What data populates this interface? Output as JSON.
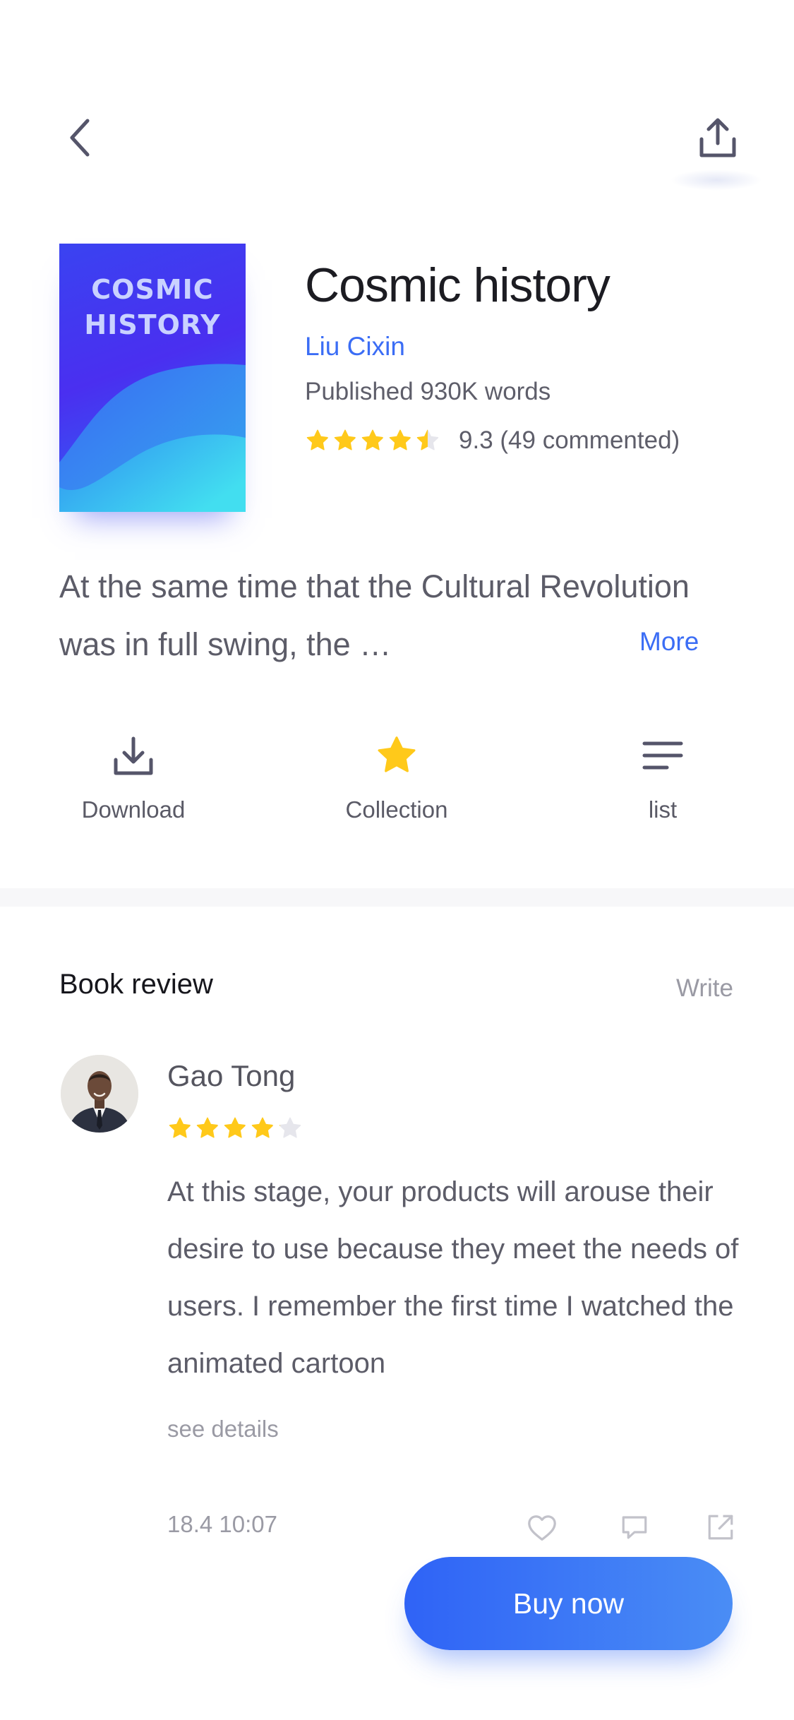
{
  "nav": {
    "back_icon": "chevron-left-icon",
    "share_icon": "share-upload-icon"
  },
  "book": {
    "cover_title": "COSMIC\nHISTORY",
    "title": "Cosmic history",
    "author": "Liu Cixin",
    "published": "Published 930K  words",
    "rating": 9.3,
    "rating_text": "9.3 (49  commented)",
    "star_fill": 4.5,
    "summary": "At the same time that the Cultural Revolution was in full swing, the …",
    "more_label": "More"
  },
  "actions": [
    {
      "label": "Download",
      "icon": "download-icon"
    },
    {
      "label": "Collection",
      "icon": "star-icon"
    },
    {
      "label": "list",
      "icon": "list-icon"
    }
  ],
  "review_section": {
    "title": "Book review",
    "write_label": "Write",
    "review": {
      "name": "Gao Tong",
      "stars": 4,
      "body": "At this stage, your products will arouse their desire to use because they meet the needs of users. I remember the first time I watched the animated cartoon",
      "see_details": "see details",
      "time": "18.4 10:07",
      "action_icons": [
        "heart-icon",
        "comment-icon",
        "external-share-icon"
      ]
    }
  },
  "buy_button": {
    "label": "Buy now"
  },
  "colors": {
    "accent": "#3b6df5",
    "star": "#ffc91a",
    "star_empty": "#e6e6ec",
    "text_secondary": "#5c5c68"
  }
}
